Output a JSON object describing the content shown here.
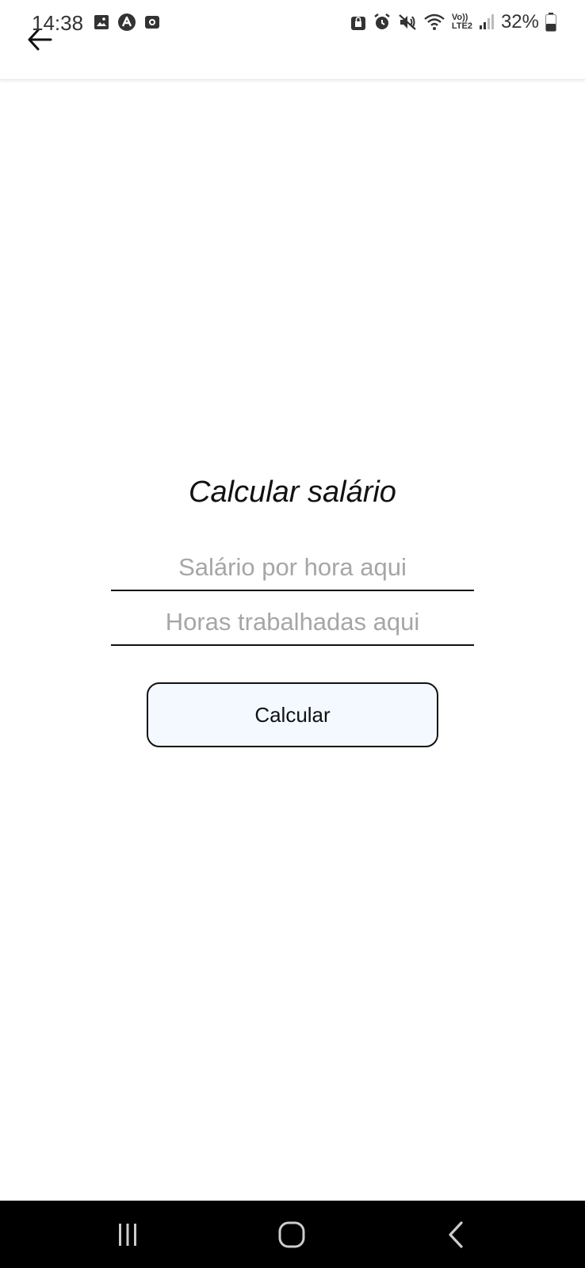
{
  "status_bar": {
    "time": "14:38",
    "battery_percent": "32%",
    "network_label": "LTE2",
    "volte_label": "Vo))",
    "left_icons": [
      "image-icon",
      "app-a-icon",
      "camera-icon"
    ],
    "right_icons": [
      "lock-box-icon",
      "alarm-icon",
      "mute-icon",
      "wifi-icon",
      "signal-icon",
      "battery-icon"
    ]
  },
  "app_bar": {
    "back_icon": "arrow-left-icon"
  },
  "main": {
    "title": "Calcular salário",
    "salary_input": {
      "placeholder": "Salário por hora aqui",
      "value": ""
    },
    "hours_input": {
      "placeholder": "Horas trabalhadas aqui",
      "value": ""
    },
    "calculate_button_label": "Calcular"
  },
  "nav_bar": {
    "items": [
      "recent-apps-icon",
      "home-icon",
      "back-icon"
    ]
  },
  "colors": {
    "background": "#ffffff",
    "button_fill": "#f3f9ff",
    "placeholder": "#a6a6a6",
    "nav_bar": "#000000"
  }
}
